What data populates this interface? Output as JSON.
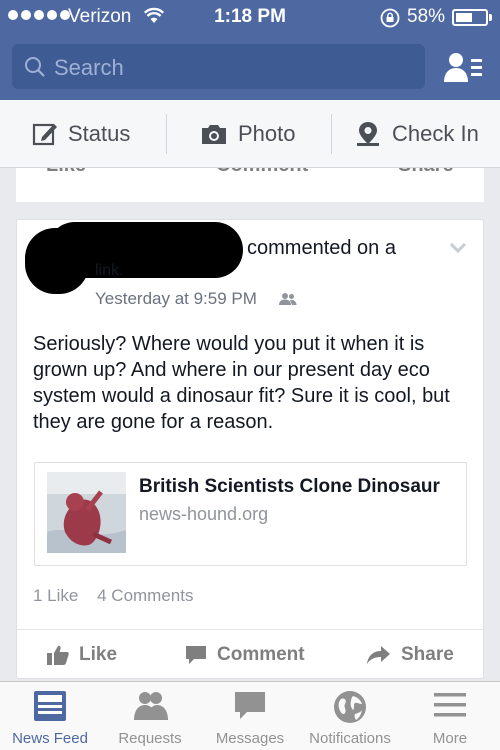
{
  "status_bar": {
    "carrier": "Verizon",
    "time": "1:18 PM",
    "battery_percent": "58%",
    "battery_level": 0.58,
    "signal_icon": "signal-dots-icon",
    "wifi_icon": "wifi-icon",
    "rotation_lock_icon": "rotation-lock-icon"
  },
  "header": {
    "search_placeholder": "Search",
    "friends_icon": "friend-requests-icon",
    "bg_color": "#4e69a2"
  },
  "composer": {
    "items": [
      {
        "label": "Status",
        "icon": "pencil-square-icon"
      },
      {
        "label": "Photo",
        "icon": "camera-icon"
      },
      {
        "label": "Check In",
        "icon": "map-pin-icon"
      }
    ]
  },
  "previous_story": {
    "actions": [
      "Like",
      "Comment",
      "Share"
    ]
  },
  "story": {
    "action_text": "commented on a",
    "action_link": "link.",
    "timestamp": "Yesterday at 9:59 PM",
    "audience_icon": "friends-audience-icon",
    "body": "Seriously? Where would you put it when it is grown up? And where in our present day eco system would a dinosaur fit? Sure it is cool, but they are gone for a reason.",
    "link": {
      "title": "British Scientists Clone Dinosaur",
      "domain": "news-hound.org"
    },
    "likes": "1 Like",
    "comments": "4 Comments",
    "buttons": {
      "like": "Like",
      "comment": "Comment",
      "share": "Share"
    }
  },
  "tabbar": {
    "tabs": [
      {
        "label": "News Feed",
        "icon": "news-feed-icon",
        "active": true
      },
      {
        "label": "Requests",
        "icon": "requests-icon",
        "active": false
      },
      {
        "label": "Messages",
        "icon": "messages-icon",
        "active": false
      },
      {
        "label": "Notifications",
        "icon": "globe-icon",
        "active": false
      },
      {
        "label": "More",
        "icon": "menu-icon",
        "active": false
      }
    ],
    "active_color": "#4e69a2",
    "inactive_color": "#929292"
  }
}
